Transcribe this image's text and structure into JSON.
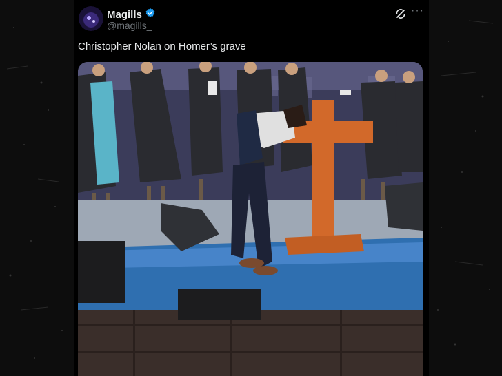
{
  "tweet": {
    "display_name": "Magills",
    "handle": "@magills_",
    "text": "Christopher Nolan on Homer’s grave",
    "verified_icon": "verified-badge-icon",
    "grok_icon": "grok-icon",
    "more_icon": "more-options-icon",
    "more_glyph": "···"
  },
  "colors": {
    "accent": "#1d9bf0",
    "text_primary": "#e7e9ea",
    "text_secondary": "#71767b",
    "background": "#000000"
  }
}
